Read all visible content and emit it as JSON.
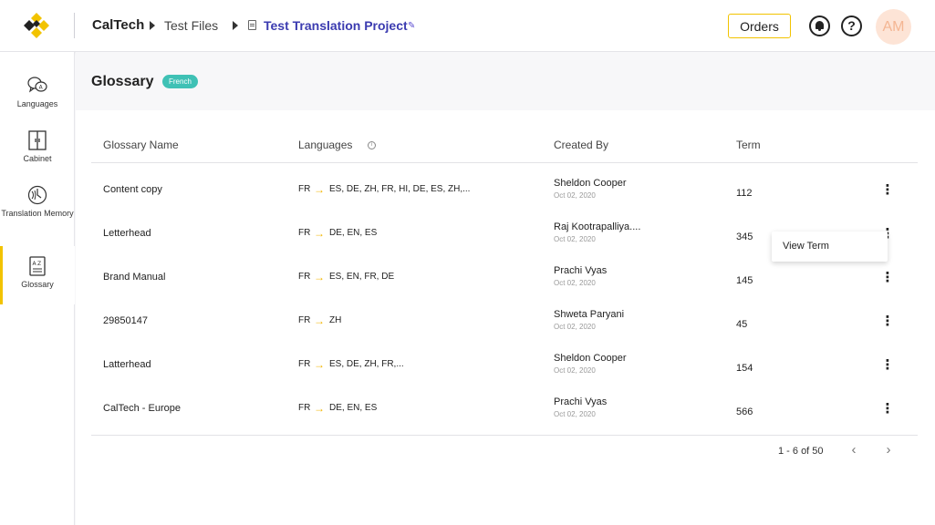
{
  "header": {
    "breadcrumb": [
      "CalTech",
      "Test Files",
      "Test Translation Project"
    ],
    "orders_label": "Orders",
    "avatar_initials": "AM"
  },
  "sidebar": {
    "items": [
      {
        "label": "Languages",
        "icon": "languages-icon"
      },
      {
        "label": "Cabinet",
        "icon": "cabinet-icon"
      },
      {
        "label": "Translation Memory",
        "icon": "translation-memory-icon"
      },
      {
        "label": "Glossary",
        "icon": "glossary-icon",
        "active": true
      }
    ]
  },
  "page": {
    "title": "Glossary",
    "badge": "French"
  },
  "table": {
    "columns": [
      "Glossary Name",
      "Languages",
      "Created By",
      "Term"
    ],
    "rows": [
      {
        "name": "Content copy",
        "source": "FR",
        "targets": "ES, DE, ZH, FR, HI, DE, ES, ZH,...",
        "creator": "Sheldon Cooper",
        "date": "Oct 02, 2020",
        "term": "112"
      },
      {
        "name": "Letterhead",
        "source": "FR",
        "targets": "DE, EN, ES",
        "creator": "Raj Kootrapalliya....",
        "date": "Oct 02, 2020",
        "term": "345"
      },
      {
        "name": "Brand Manual",
        "source": "FR",
        "targets": "ES, EN, FR, DE",
        "creator": "Prachi Vyas",
        "date": "Oct 02, 2020",
        "term": "145"
      },
      {
        "name": "29850147",
        "source": "FR",
        "targets": "ZH",
        "creator": "Shweta Paryani",
        "date": "Oct 02, 2020",
        "term": "45"
      },
      {
        "name": "Latterhead",
        "source": "FR",
        "targets": "ES, DE, ZH, FR,...",
        "creator": "Sheldon Cooper",
        "date": "Oct 02, 2020",
        "term": "154"
      },
      {
        "name": "CalTech - Europe",
        "source": "FR",
        "targets": "DE, EN, ES",
        "creator": "Prachi Vyas",
        "date": "Oct 02, 2020",
        "term": "566"
      }
    ]
  },
  "context_menu": {
    "items": [
      "View Term"
    ]
  },
  "pagination": {
    "text": "1 - 6 of 50"
  },
  "colors": {
    "accent": "#f2c300",
    "badge": "#3fc1b5",
    "link": "#3b3bb0"
  }
}
